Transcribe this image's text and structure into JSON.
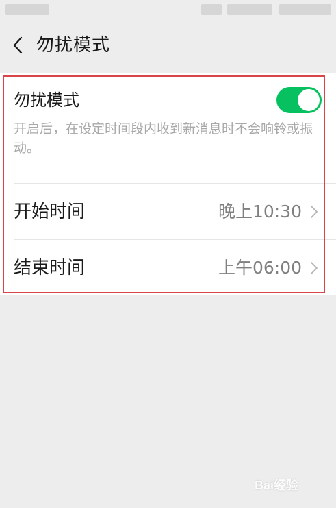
{
  "nav": {
    "title": "勿扰模式"
  },
  "dnd": {
    "label": "勿扰模式",
    "enabled": true,
    "description": "开启后，在设定时间段内收到新消息时不会响铃或振动。"
  },
  "rows": [
    {
      "label": "开始时间",
      "value": "晚上10:30"
    },
    {
      "label": "结束时间",
      "value": "上午06:00"
    }
  ],
  "watermark": {
    "text": "Bai经验"
  },
  "colors": {
    "toggle_on": "#07c160",
    "highlight_border": "#d8464a",
    "background": "#ededed"
  },
  "icons": {
    "back": "chevron-left-icon",
    "row_arrow": "chevron-right-icon"
  }
}
